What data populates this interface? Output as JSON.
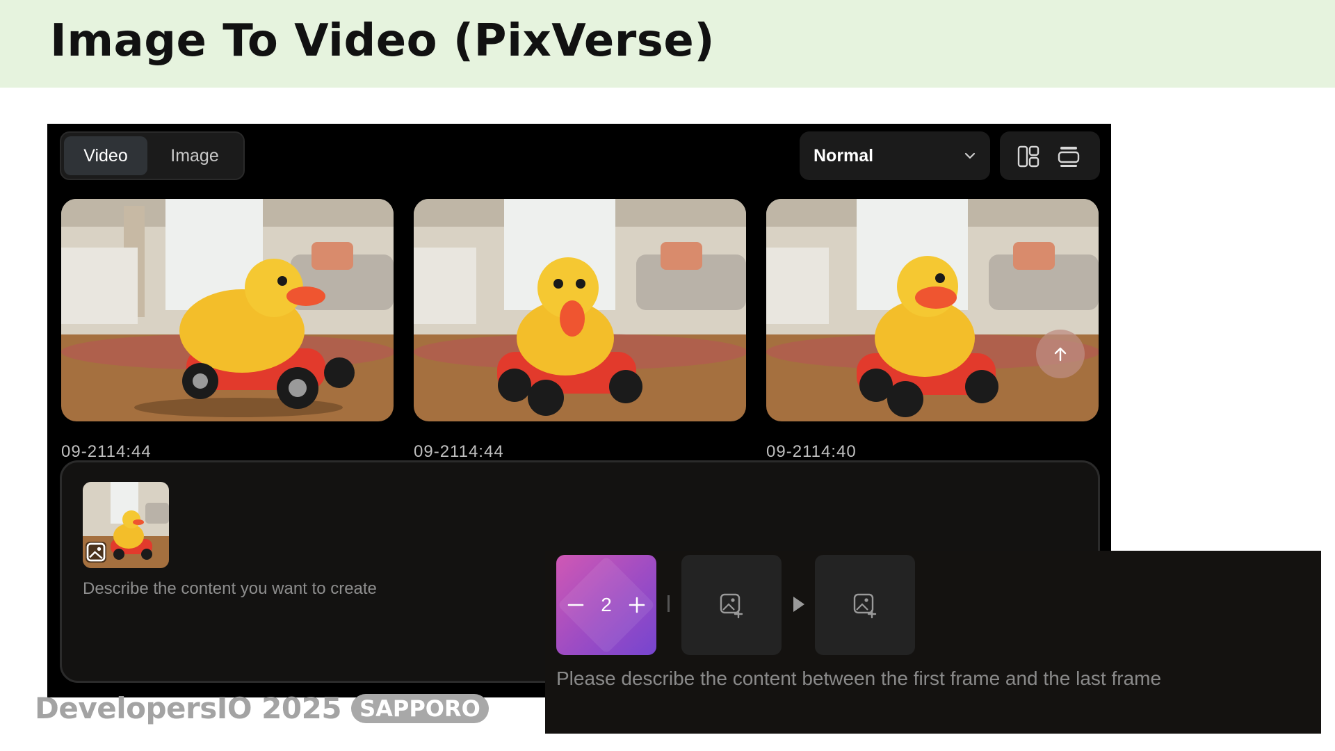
{
  "slide": {
    "title": "Image To Video (PixVerse)"
  },
  "app": {
    "mode_tabs": [
      {
        "label": "Video",
        "active": true
      },
      {
        "label": "Image",
        "active": false
      }
    ],
    "quality_select": {
      "selected": "Normal"
    },
    "view_icons": [
      "grid-layout-icon",
      "list-layout-icon"
    ],
    "gallery": [
      {
        "timestamp": "09-2114:44"
      },
      {
        "timestamp": "09-2114:44"
      },
      {
        "timestamp": "09-2114:40"
      }
    ],
    "scroll_top_icon": "arrow-up-icon",
    "prompt": {
      "placeholder": "Describe the content you want to create"
    }
  },
  "frames_panel": {
    "count": "2",
    "minus_icon": "minus-icon",
    "plus_icon": "plus-icon",
    "first_frame_icon": "add-image-icon",
    "last_frame_icon": "add-image-icon",
    "placeholder": "Please describe the content between the first frame and the last frame"
  },
  "watermark": {
    "brand": "DevelopersIO 2025",
    "city": "SAPPORO"
  },
  "colors": {
    "header_bg": "#e6f3de",
    "app_bg": "#000000",
    "counter_gradient_start": "#d058b4",
    "counter_gradient_end": "#7645cf"
  }
}
